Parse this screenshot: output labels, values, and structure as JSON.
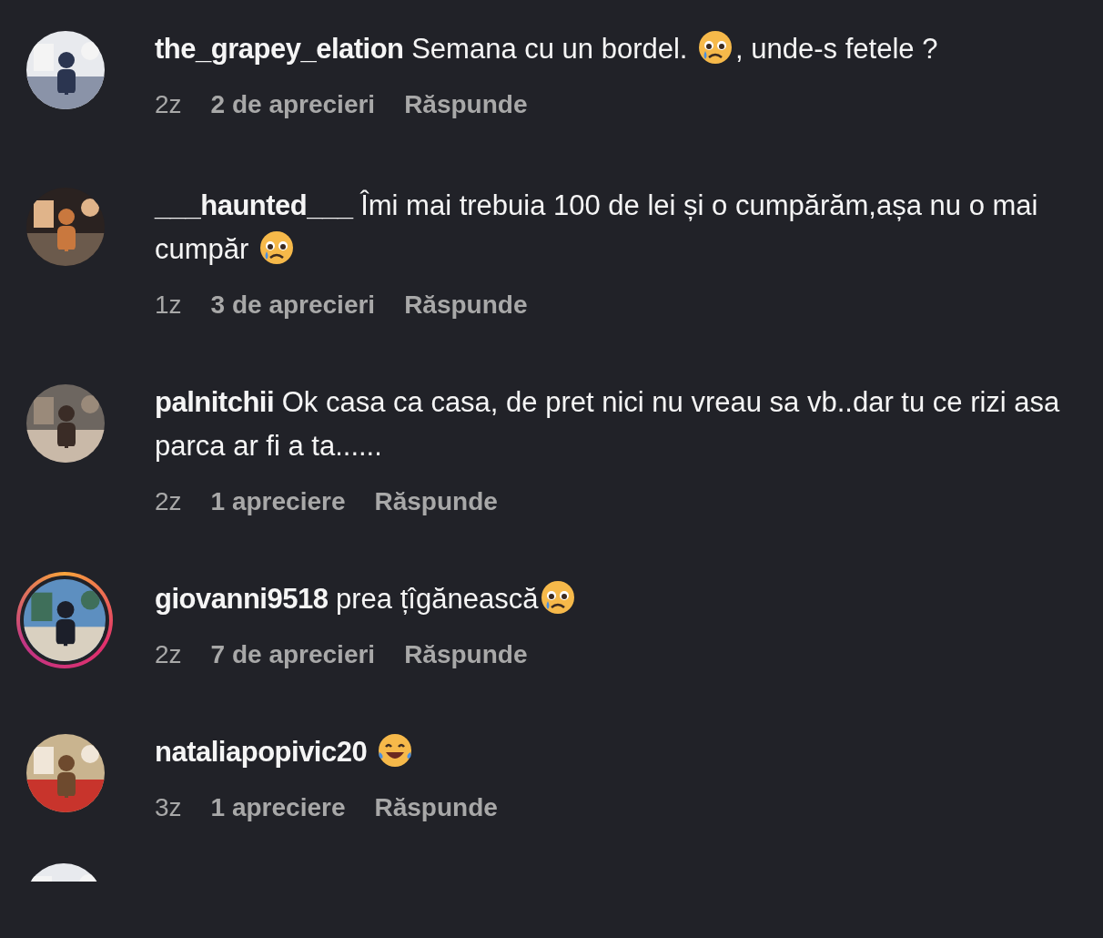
{
  "comments": [
    {
      "avatar": {
        "kind": "picture",
        "story": false
      },
      "username": "the_grapey_elation",
      "parts": [
        {
          "kind": "text",
          "text": "Semana cu un bordel. "
        },
        {
          "kind": "tear"
        },
        {
          "kind": "text",
          "text": ", unde-s fetele ?"
        }
      ],
      "time": "2z",
      "likes": "2 de aprecieri",
      "reply": "Răspunde"
    },
    {
      "avatar": {
        "kind": "picture",
        "story": false
      },
      "username": "___haunted___",
      "parts": [
        {
          "kind": "text",
          "text": "Îmi mai trebuia 100 de lei și o cumpărăm,așa nu o mai cumpăr "
        },
        {
          "kind": "tear"
        }
      ],
      "time": "1z",
      "likes": "3 de aprecieri",
      "reply": "Răspunde"
    },
    {
      "avatar": {
        "kind": "picture",
        "story": false
      },
      "username": "palnitchii",
      "parts": [
        {
          "kind": "text",
          "text": "Ok casa ca casa, de pret nici nu vreau sa vb..dar tu ce rizi asa parca ar fi a ta......"
        }
      ],
      "time": "2z",
      "likes": "1 apreciere",
      "reply": "Răspunde"
    },
    {
      "avatar": {
        "kind": "picture",
        "story": true
      },
      "username": "giovanni9518",
      "parts": [
        {
          "kind": "text",
          "text": "prea țîgănească"
        },
        {
          "kind": "tear"
        }
      ],
      "time": "2z",
      "likes": "7 de aprecieri",
      "reply": "Răspunde"
    },
    {
      "avatar": {
        "kind": "picture",
        "story": false
      },
      "username": "nataliapopivic20",
      "parts": [
        {
          "kind": "laugh"
        }
      ],
      "time": "3z",
      "likes": "1 apreciere",
      "reply": "Răspunde"
    }
  ],
  "partial_avatar": {
    "kind": "picture"
  }
}
